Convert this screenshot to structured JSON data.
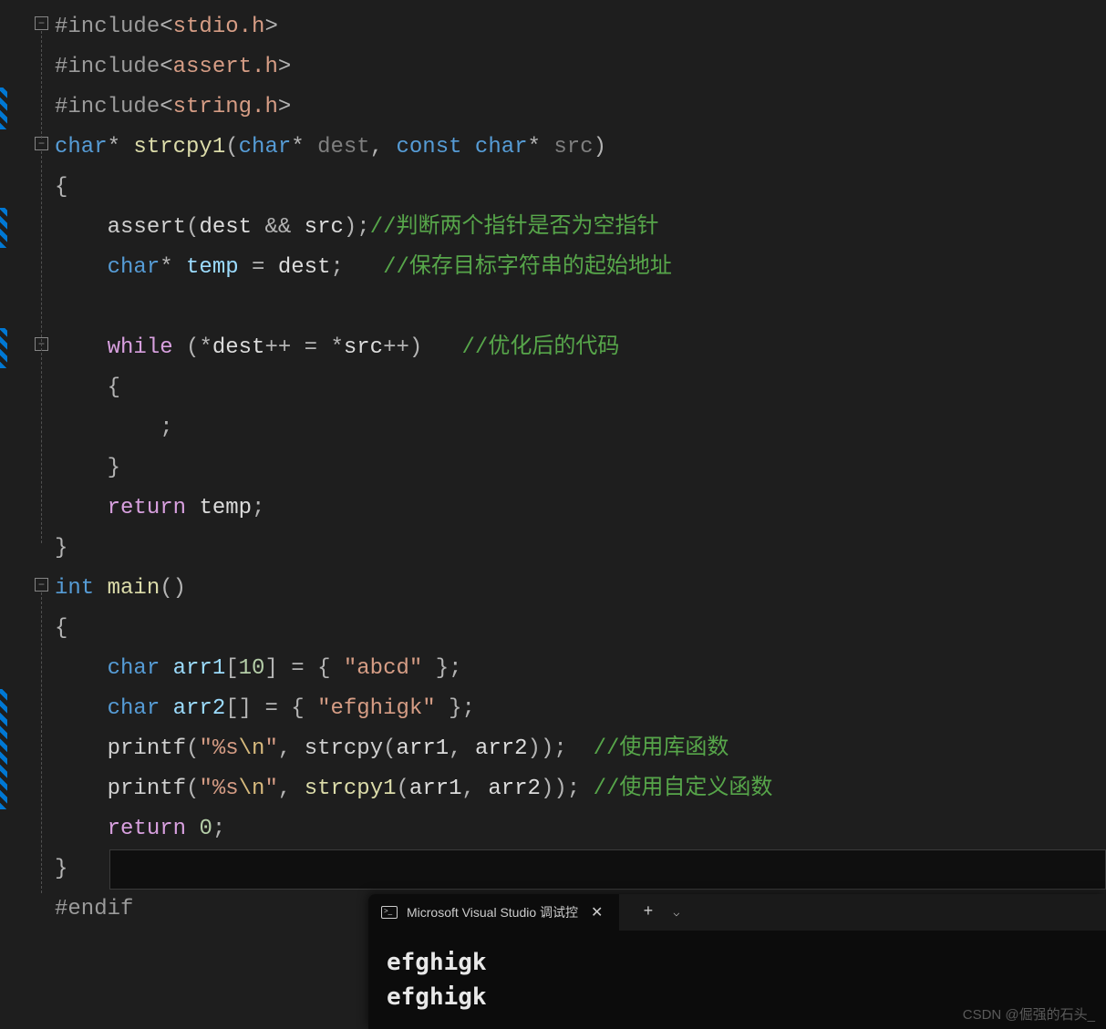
{
  "code": {
    "l1": {
      "inc": "#include",
      "h": "stdio.h"
    },
    "l2": {
      "inc": "#include",
      "h": "assert.h"
    },
    "l3": {
      "inc": "#include",
      "h": "string.h"
    },
    "l4": {
      "kw_char": "char",
      "star": "*",
      "fn": "strcpy1",
      "p_char1": "char",
      "p_dest": "dest",
      "p_const": "const",
      "p_char2": "char",
      "p_src": "src"
    },
    "l5": {
      "brace": "{"
    },
    "l6": {
      "assert": "assert",
      "dest": "dest",
      "and": "&&",
      "src": "src",
      "comment": "//判断两个指针是否为空指针"
    },
    "l7": {
      "kw_char": "char",
      "star": "*",
      "temp": "temp",
      "eq": "=",
      "dest": "dest",
      "comment": "//保存目标字符串的起始地址"
    },
    "l9": {
      "while": "while",
      "dest": "dest",
      "src": "src",
      "comment": "//优化后的代码"
    },
    "l10": {
      "brace": "{"
    },
    "l11": {
      "semi": ";"
    },
    "l12": {
      "brace": "}"
    },
    "l13": {
      "return": "return",
      "temp": "temp"
    },
    "l14": {
      "brace": "}"
    },
    "l15": {
      "int": "int",
      "main": "main"
    },
    "l16": {
      "brace": "{"
    },
    "l17": {
      "char": "char",
      "arr1": "arr1",
      "size": "10",
      "str": "\"abcd\""
    },
    "l18": {
      "char": "char",
      "arr2": "arr2",
      "str": "\"efghigk\""
    },
    "l19": {
      "printf": "printf",
      "fmt": "\"%s",
      "esc": "\\n",
      "fmt2": "\"",
      "strcpy": "strcpy",
      "arr1": "arr1",
      "arr2": "arr2",
      "comment": "//使用库函数"
    },
    "l20": {
      "printf": "printf",
      "fmt": "\"%s",
      "esc": "\\n",
      "fmt2": "\"",
      "strcpy1": "strcpy1",
      "arr1": "arr1",
      "arr2": "arr2",
      "comment": "//使用自定义函数"
    },
    "l21": {
      "return": "return",
      "zero": "0"
    },
    "l22": {
      "brace": "}"
    },
    "l23": {
      "endif": "#endif"
    }
  },
  "terminal": {
    "tab_title": "Microsoft Visual Studio 调试控",
    "output": [
      "efghigk",
      "efghigk"
    ]
  },
  "watermark": "CSDN @倔强的石头_",
  "fold_minus": "−"
}
